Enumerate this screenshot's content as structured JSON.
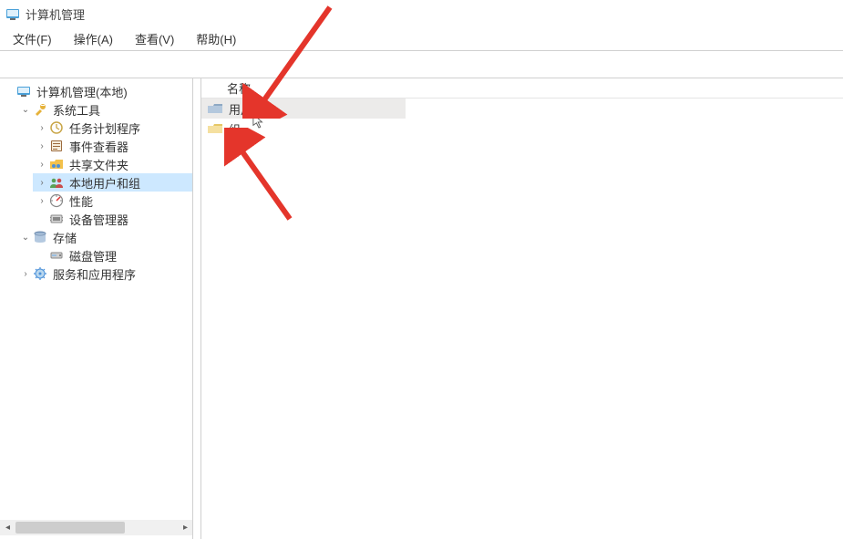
{
  "window": {
    "title": "计算机管理"
  },
  "menu": {
    "file": "文件(F)",
    "action": "操作(A)",
    "view": "查看(V)",
    "help": "帮助(H)"
  },
  "tree": {
    "root": {
      "label": "计算机管理(本地)"
    },
    "system_tools": {
      "label": "系统工具",
      "task_scheduler": "任务计划程序",
      "event_viewer": "事件查看器",
      "shared_folders": "共享文件夹",
      "local_users_groups": "本地用户和组",
      "performance": "性能",
      "device_manager": "设备管理器"
    },
    "storage": {
      "label": "存储",
      "disk_management": "磁盘管理"
    },
    "services_apps": {
      "label": "服务和应用程序"
    }
  },
  "list": {
    "header_name": "名称",
    "rows": {
      "users": "用户",
      "groups": "组"
    }
  }
}
